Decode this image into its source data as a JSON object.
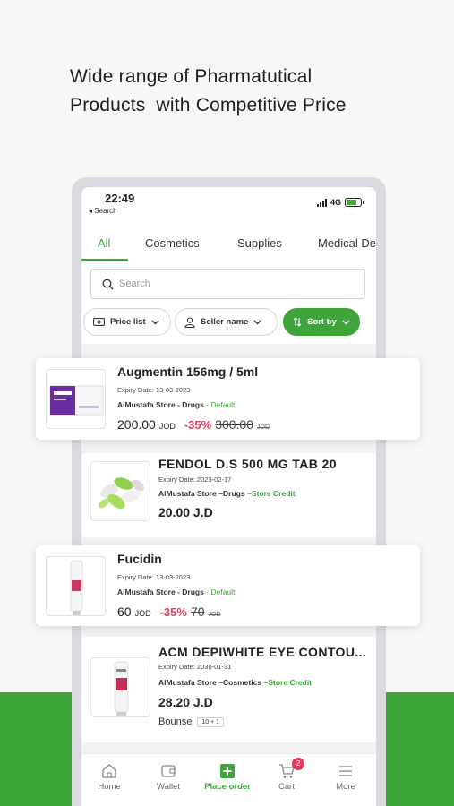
{
  "headline": {
    "line1": "Wide range of Pharmatutical",
    "line2": "Products  with Competitive Price"
  },
  "status_bar": {
    "time": "22:49",
    "back_label": "◂ Search",
    "network": "4G"
  },
  "tabs": [
    {
      "label": "All",
      "active": true
    },
    {
      "label": "Cosmetics"
    },
    {
      "label": "Supplies"
    },
    {
      "label": "Medical De"
    }
  ],
  "search": {
    "placeholder": "Search"
  },
  "filters": {
    "price_list": "Price list",
    "seller_name": "Seller name",
    "sort_by": "Sort by"
  },
  "products": [
    {
      "name": "Augmentin 156mg / 5ml",
      "expiry": "Expiry Date: 13-03-2023",
      "store": "AlMustafa Store - Drugs",
      "store_tag": "- Default",
      "price": "200.00",
      "currency": "JOD",
      "discount": "-35%",
      "old_price": "300.00",
      "old_currency": "JOD"
    },
    {
      "name": "FENDOL D.S 500 MG TAB 20",
      "expiry": "Expiry Date: 2023-02-17",
      "store": "AlMustafa Store ~Drugs",
      "store_tag": "~Store Credit",
      "price": "20.00 J.D"
    },
    {
      "name": "Fucidin",
      "expiry": "Expiry Date: 13-03-2023",
      "store": "AlMustafa Store - Drugs",
      "store_tag": "- Default",
      "price": "60",
      "currency": "JOD",
      "discount": "-35%",
      "old_price": "70",
      "old_currency": "JOD"
    },
    {
      "name": "ACM DEPIWHITE EYE CONTOU...",
      "expiry": "Expiry Date: 2030-01-31",
      "store": "AlMustafa Store ~Cosmetics",
      "store_tag": "~Store Credit",
      "price": "28.20 J.D",
      "bonus_label": "Bounse",
      "bonus_value": "10 + 1"
    }
  ],
  "bottom_nav": [
    {
      "label": "Home",
      "icon": "home-icon"
    },
    {
      "label": "Wallet",
      "icon": "wallet-icon"
    },
    {
      "label": "Place order",
      "icon": "plus-square-icon",
      "active": true
    },
    {
      "label": "Cart",
      "icon": "cart-icon",
      "badge": "2"
    },
    {
      "label": "More",
      "icon": "menu-icon"
    }
  ],
  "colors": {
    "accent": "#3fa53b",
    "discount": "#e23a58",
    "background": "#f7f7f7"
  }
}
